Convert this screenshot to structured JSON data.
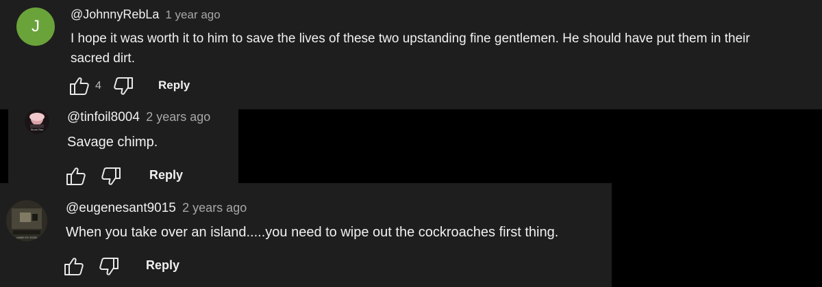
{
  "comments": [
    {
      "avatar_letter": "J",
      "avatar_color": "#6aa33a",
      "handle": "@JohnnyRebLa",
      "time": "1 year ago",
      "text_line1": "I hope it was worth it to him to save the lives of these two upstanding fine gentlemen. He should have put them in their",
      "text_line2": "sacred dirt.",
      "like_count": "4",
      "reply_label": "Reply"
    },
    {
      "avatar_caption": "Stonk Rax",
      "handle": "@tinfoil8004",
      "time": "2 years ago",
      "text": "Savage chimp.",
      "reply_label": "Reply"
    },
    {
      "avatar_caption": "LIMBS RY ESSE",
      "handle": "@eugenesant9015",
      "time": "2 years ago",
      "text": "When you take over an island.....you need to wipe out the cockroaches first thing.",
      "reply_label": "Reply"
    }
  ],
  "colors": {
    "panel": "#1e1e1e",
    "background": "#000000",
    "text": "#f1f1f1",
    "muted": "#a8a8a8"
  },
  "icons": [
    "thumbs-up-icon",
    "thumbs-down-icon"
  ]
}
